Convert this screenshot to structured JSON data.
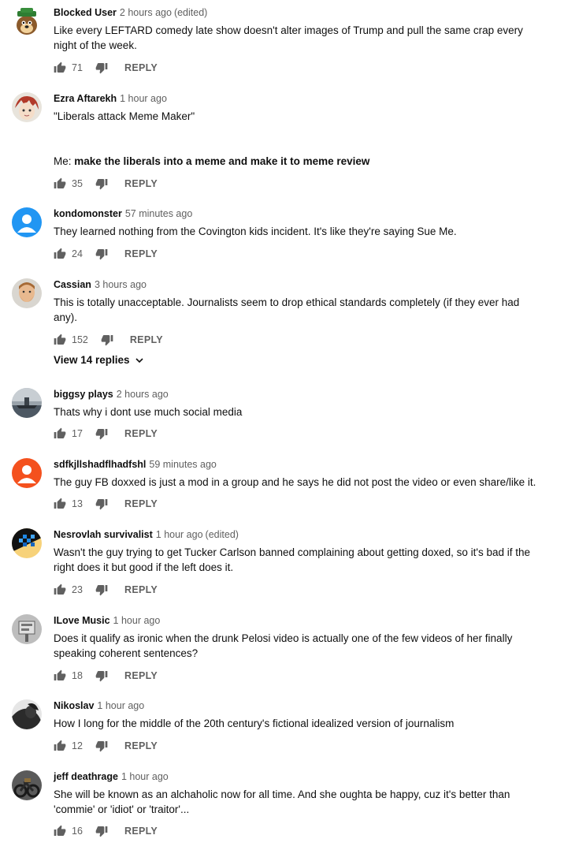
{
  "comments": [
    {
      "author": "Blocked User",
      "time": "2 hours ago",
      "edited": "(edited)",
      "text": [
        "Like every  LEFTARD  comedy late show doesn't alter images of Trump and pull the same crap every",
        "night of the week."
      ],
      "likes": "71",
      "reply": "REPLY",
      "avatar": "cartoon-bear-avatar"
    },
    {
      "author": "Ezra Aftarekh",
      "time": "1 hour ago",
      "edited": "",
      "text": [
        "\"Liberals attack Meme Maker\""
      ],
      "text2_prefix": "Me: ",
      "text2_bold": "make the liberals into a meme and make it to meme review",
      "likes": "35",
      "reply": "REPLY",
      "avatar": "anime-avatar"
    },
    {
      "author": "kondomonster",
      "time": "57 minutes ago",
      "edited": "",
      "text": [
        "They learned nothing from the Covington kids incident. It's like they're saying Sue Me."
      ],
      "likes": "24",
      "reply": "REPLY",
      "avatar": "default-blue-avatar"
    },
    {
      "author": "Cassian",
      "time": "3 hours ago",
      "edited": "",
      "text": [
        "This is totally unacceptable. Journalists seem to drop ethical standards completely (if they ever had",
        "any)."
      ],
      "likes": "152",
      "reply": "REPLY",
      "view_replies": "View 14 replies",
      "avatar": "bearded-man-avatar"
    },
    {
      "author": "biggsy plays",
      "time": "2 hours ago",
      "edited": "",
      "text": [
        "Thats why i dont use much social media"
      ],
      "likes": "17",
      "reply": "REPLY",
      "avatar": "ship-avatar"
    },
    {
      "author": "sdfkjllshadflhadfshl",
      "time": "59 minutes ago",
      "edited": "",
      "text": [
        "The guy FB doxxed is just a mod in a group and he says he did not post the video or even share/like it."
      ],
      "likes": "13",
      "reply": "REPLY",
      "avatar": "default-orange-avatar"
    },
    {
      "author": "Nesrovlah survivalist",
      "time": "1 hour ago",
      "edited": "(edited)",
      "text": [
        "Wasn't the guy trying to get Tucker Carlson banned complaining about getting doxed, so it's bad if the",
        "right does it but good if the left does it."
      ],
      "likes": "23",
      "reply": "REPLY",
      "avatar": "pixel-art-avatar"
    },
    {
      "author": "ILove Music",
      "time": "1 hour ago",
      "edited": "",
      "text": [
        "Does it qualify as ironic when the drunk Pelosi video is actually one of the few videos of her finally",
        "speaking coherent sentences?"
      ],
      "likes": "18",
      "reply": "REPLY",
      "avatar": "music-sign-avatar"
    },
    {
      "author": "Nikoslav",
      "time": "1 hour ago",
      "edited": "",
      "text": [
        "How I long for the middle of the 20th century's fictional idealized version of journalism"
      ],
      "likes": "12",
      "reply": "REPLY",
      "avatar": "dark-photo-avatar"
    },
    {
      "author": "jeff deathrage",
      "time": "1 hour ago",
      "edited": "",
      "text": [
        "She will be known as an alchaholic now for all time. And she oughta be happy, cuz it's better than",
        "'commie' or 'idiot' or 'traitor'..."
      ],
      "likes": "16",
      "reply": "REPLY",
      "avatar": "motorcycle-avatar"
    }
  ]
}
